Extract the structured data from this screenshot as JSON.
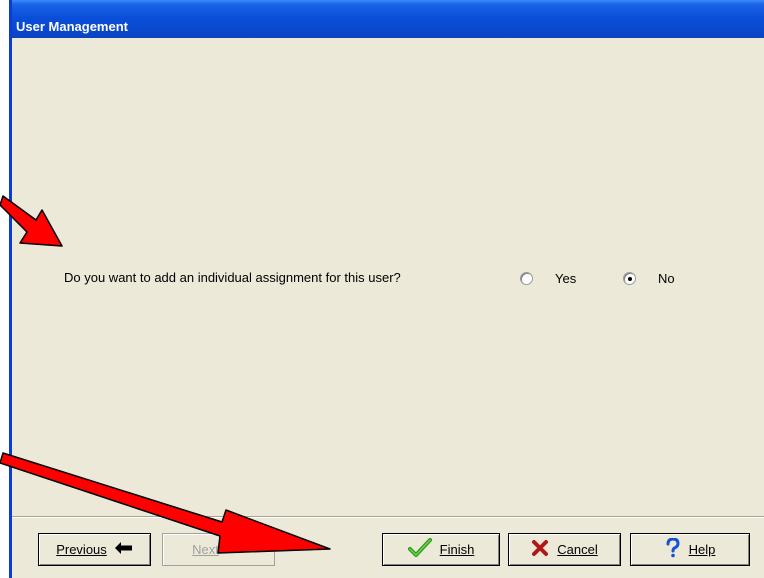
{
  "window": {
    "title": "User Management"
  },
  "question": {
    "text": "Do you want to add an individual assignment for this user?",
    "options": [
      {
        "label": "Yes",
        "checked": false
      },
      {
        "label": "No",
        "checked": true
      }
    ]
  },
  "buttons": {
    "previous": {
      "label": "Previous",
      "icon": "left-arrow-icon"
    },
    "next": {
      "label": "Next",
      "icon": "right-arrow-icon",
      "enabled": false
    },
    "finish": {
      "label": "Finish",
      "icon": "checkmark-icon"
    },
    "cancel": {
      "label": "Cancel",
      "icon": "x-icon"
    },
    "help": {
      "label": "Help",
      "icon": "question-mark-icon"
    }
  },
  "annotations": {
    "arrow_color": "#ff0000"
  }
}
